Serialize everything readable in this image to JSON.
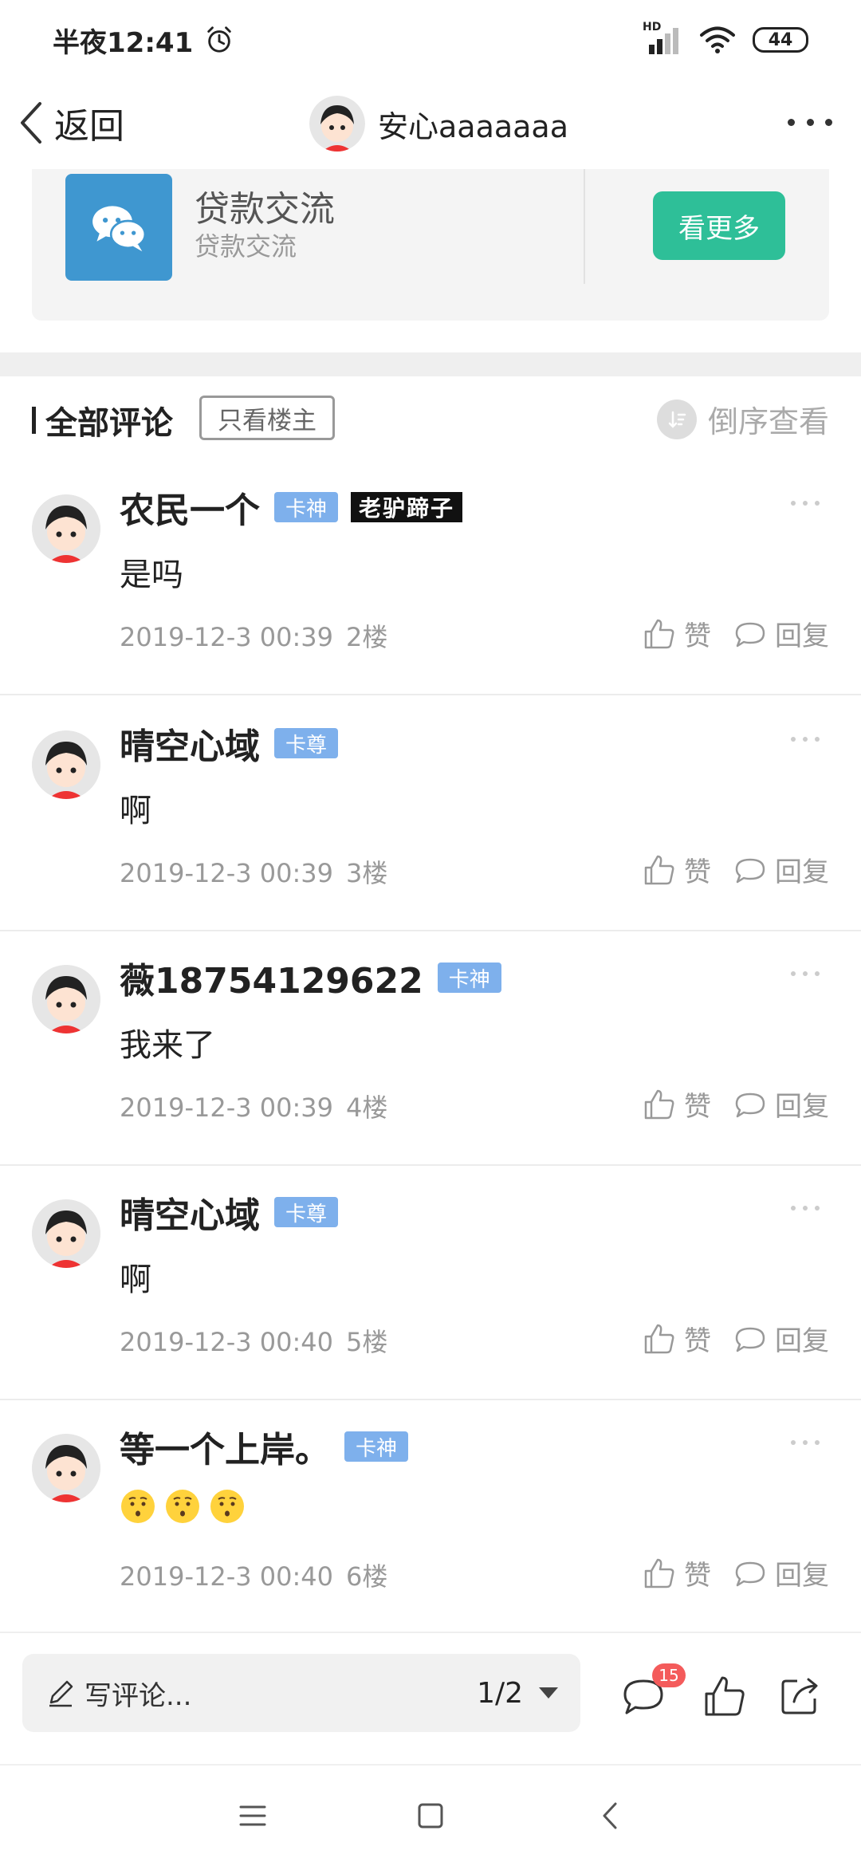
{
  "status_bar": {
    "time": "半夜12:41",
    "network": "HD",
    "battery": "44"
  },
  "nav": {
    "back_label": "返回",
    "title": "安心aaaaaaa"
  },
  "group": {
    "name": "贷款交流",
    "subtitle": "贷款交流",
    "see_more_label": "看更多"
  },
  "comments_header": {
    "title": "全部评论",
    "op_only_label": "只看楼主",
    "sort_label": "倒序查看"
  },
  "comments": [
    {
      "name": "农民一个",
      "badge": "卡神",
      "extra_badge": "老驴蹄子",
      "text": "是吗",
      "time": "2019-12-3 00:39",
      "floor": "2楼",
      "like_label": "赞",
      "reply_label": "回复"
    },
    {
      "name": "晴空心域",
      "badge": "卡尊",
      "text": "啊",
      "time": "2019-12-3 00:39",
      "floor": "3楼",
      "like_label": "赞",
      "reply_label": "回复"
    },
    {
      "name": "薇18754129622",
      "badge": "卡神",
      "text": "我来了",
      "time": "2019-12-3 00:39",
      "floor": "4楼",
      "like_label": "赞",
      "reply_label": "回复"
    },
    {
      "name": "晴空心域",
      "badge": "卡尊",
      "text": "啊",
      "time": "2019-12-3 00:40",
      "floor": "5楼",
      "like_label": "赞",
      "reply_label": "回复"
    },
    {
      "name": "等一个上岸。",
      "badge": "卡神",
      "emojis": [
        "thinking-face",
        "thinking-face",
        "thinking-face"
      ],
      "time": "2019-12-3 00:40",
      "floor": "6楼",
      "like_label": "赞",
      "reply_label": "回复"
    }
  ],
  "bottom_bar": {
    "write_placeholder": "写评论...",
    "page_indicator": "1/2",
    "comment_count": "15"
  },
  "colors": {
    "accent_green": "#2ebf98",
    "badge_blue": "#7eb0ec",
    "group_icon_blue": "#3f97d0",
    "notification_red": "#f45b5b"
  }
}
